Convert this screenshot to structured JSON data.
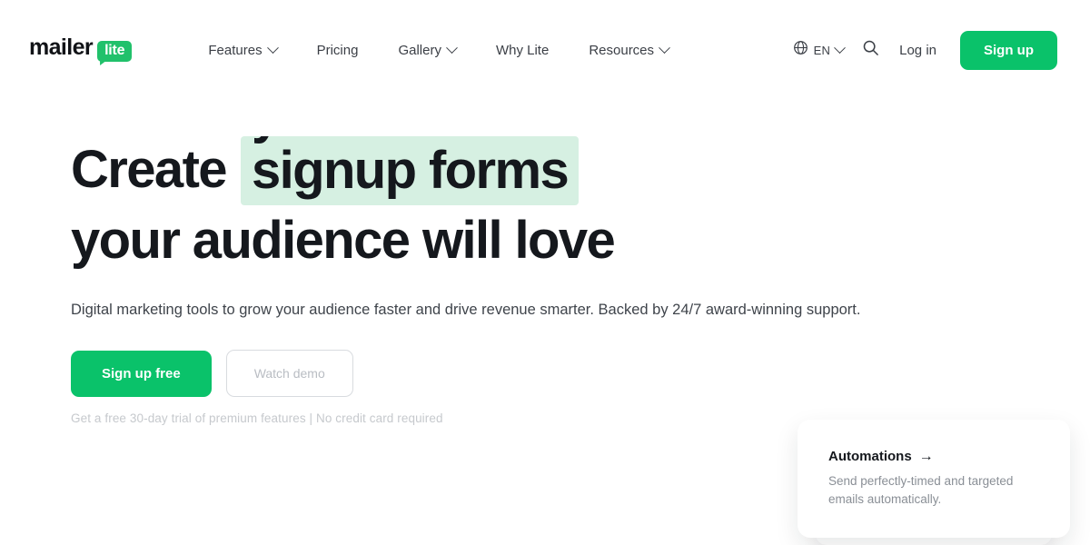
{
  "brand": {
    "name": "mailer",
    "badge": "lite",
    "green": "#0ac26a",
    "highlight": "#d6f0e2"
  },
  "header": {
    "nav": [
      {
        "label": "Features",
        "has_chevron": true
      },
      {
        "label": "Pricing",
        "has_chevron": false
      },
      {
        "label": "Gallery",
        "has_chevron": true
      },
      {
        "label": "Why Lite",
        "has_chevron": false
      },
      {
        "label": "Resources",
        "has_chevron": true
      }
    ],
    "language": "EN",
    "login_label": "Log in",
    "signup_label": "Sign up"
  },
  "hero": {
    "headline_prefix": "Create",
    "headline_rotating": "signup forms",
    "headline_line2": "your audience will love",
    "subhead": "Digital marketing tools to grow your audience faster and drive revenue smarter. Backed by 24/7 award-winning support.",
    "primary_cta": "Sign up free",
    "secondary_cta": "Watch demo",
    "fineprint": "Get a free 30-day trial of premium features | No credit card required"
  },
  "feature_card": {
    "title": "Automations",
    "arrow": "→",
    "description": "Send perfectly-timed and targeted emails automatically."
  }
}
